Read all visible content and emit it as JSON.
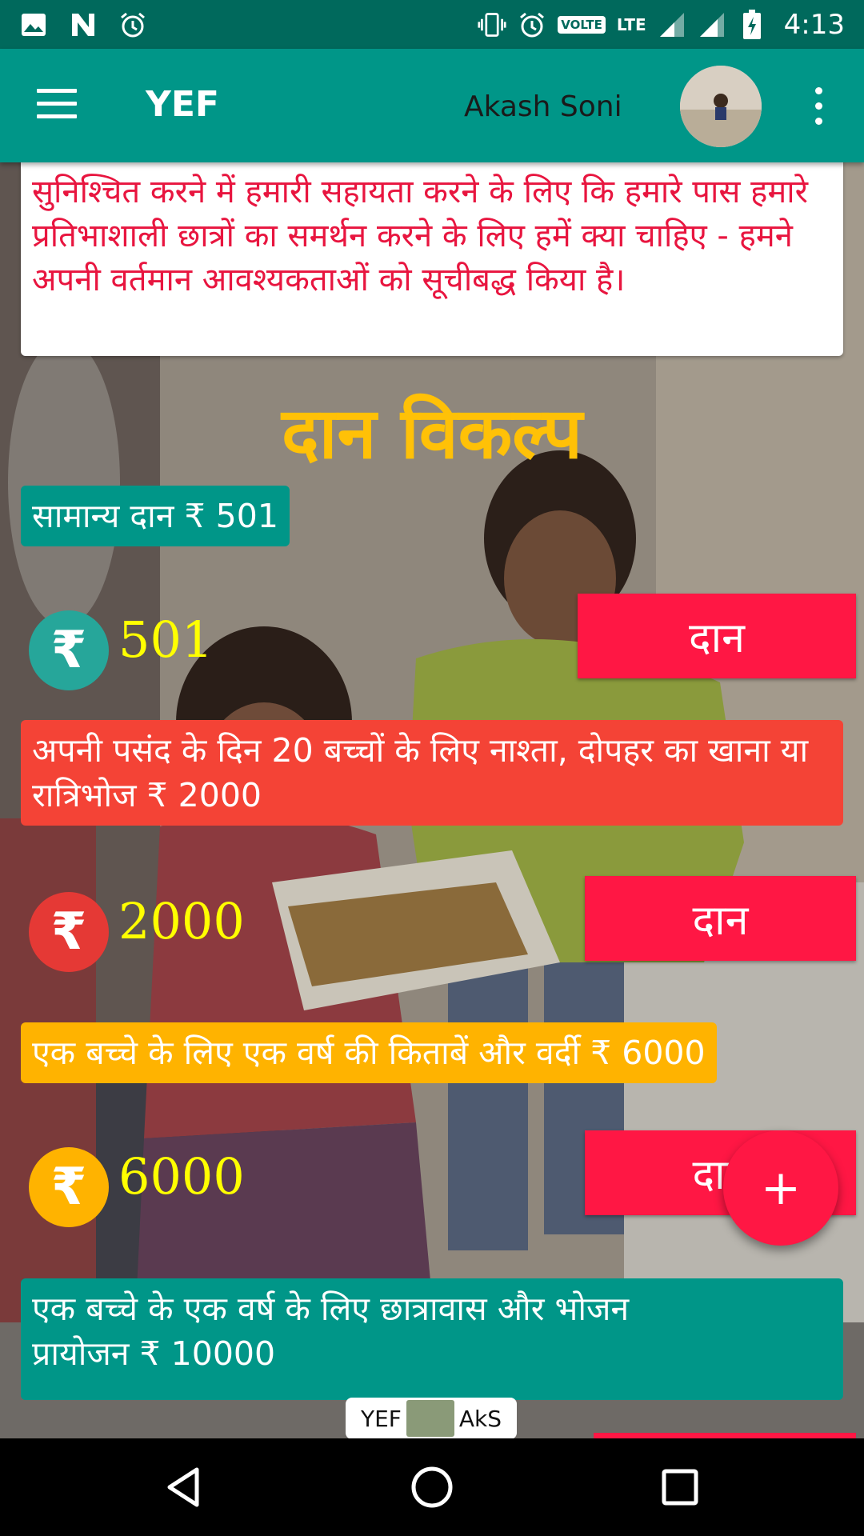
{
  "status_bar": {
    "time": "4:13",
    "volte": "VOLTE",
    "network": "LTE",
    "icons": [
      "image-icon",
      "n-icon",
      "alarm-icon",
      "vibrate-icon",
      "alarm-icon",
      "signal-icon",
      "signal-icon",
      "battery-charging-icon"
    ]
  },
  "app_bar": {
    "title": "YEF",
    "user_name": "Akash Soni",
    "menu_icon": "hamburger-icon",
    "more_icon": "more-vert-icon"
  },
  "intro_card": {
    "text": "सुनिश्चित करने में हमारी सहायता करने के लिए कि हमारे पास हमारे प्रतिभाशाली छात्रों का समर्थन करने के लिए हमें क्या चाहिए - हमने अपनी वर्तमान आवश्यकताओं को सूचीबद्ध किया है।"
  },
  "section_title": "दान विकल्प",
  "options": [
    {
      "label": "सामान्य दान ₹ 501",
      "amount": "501",
      "button": "दान",
      "color": "#009688",
      "icon": "rupee-icon"
    },
    {
      "label": "अपनी पसंद के दिन 20 बच्चों के लिए नाश्ता, दोपहर का खाना या रात्रिभोज ₹ 2000",
      "amount": "2000",
      "button": "दान",
      "color": "#f44336",
      "icon": "rupee-icon"
    },
    {
      "label": "एक बच्चे के लिए एक वर्ष की किताबें और वर्दी ₹ 6000",
      "amount": "6000",
      "button": "दान",
      "color": "#ffb300",
      "icon": "rupee-icon"
    },
    {
      "label": "एक बच्चे के एक वर्ष के लिए छात्रावास और भोजन प्रायोजन ₹ 10000",
      "color": "#009688"
    }
  ],
  "fab": {
    "label": "+"
  },
  "watermark": {
    "left": "YEF",
    "right": "AkS"
  },
  "colors": {
    "primary": "#009688",
    "primary_dark": "#00695c",
    "accent": "#ff1744",
    "title_yellow": "#ffc107",
    "amount_yellow": "#ffff00"
  }
}
